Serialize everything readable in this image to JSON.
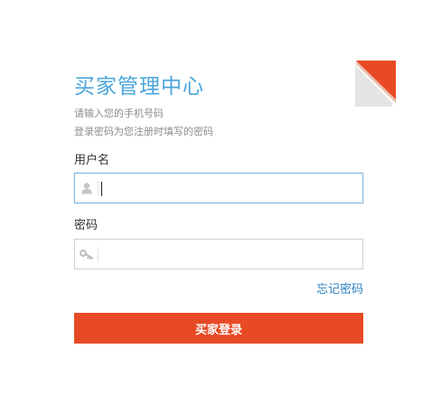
{
  "header": {
    "title": "买家管理中心",
    "hint_line_1": "请输入您的手机号码",
    "hint_line_2": "登录密码为您注册时填写的密码"
  },
  "form": {
    "username": {
      "label": "用户名",
      "value": "",
      "icon": "user-icon"
    },
    "password": {
      "label": "密码",
      "value": "",
      "icon": "key-icon"
    },
    "forgot_password_label": "忘记密码",
    "submit_label": "买家登录"
  },
  "colors": {
    "title": "#4aa6da",
    "accent": "#e84a25",
    "link": "#2b7fc0",
    "focused_border": "#7fb9e6"
  }
}
